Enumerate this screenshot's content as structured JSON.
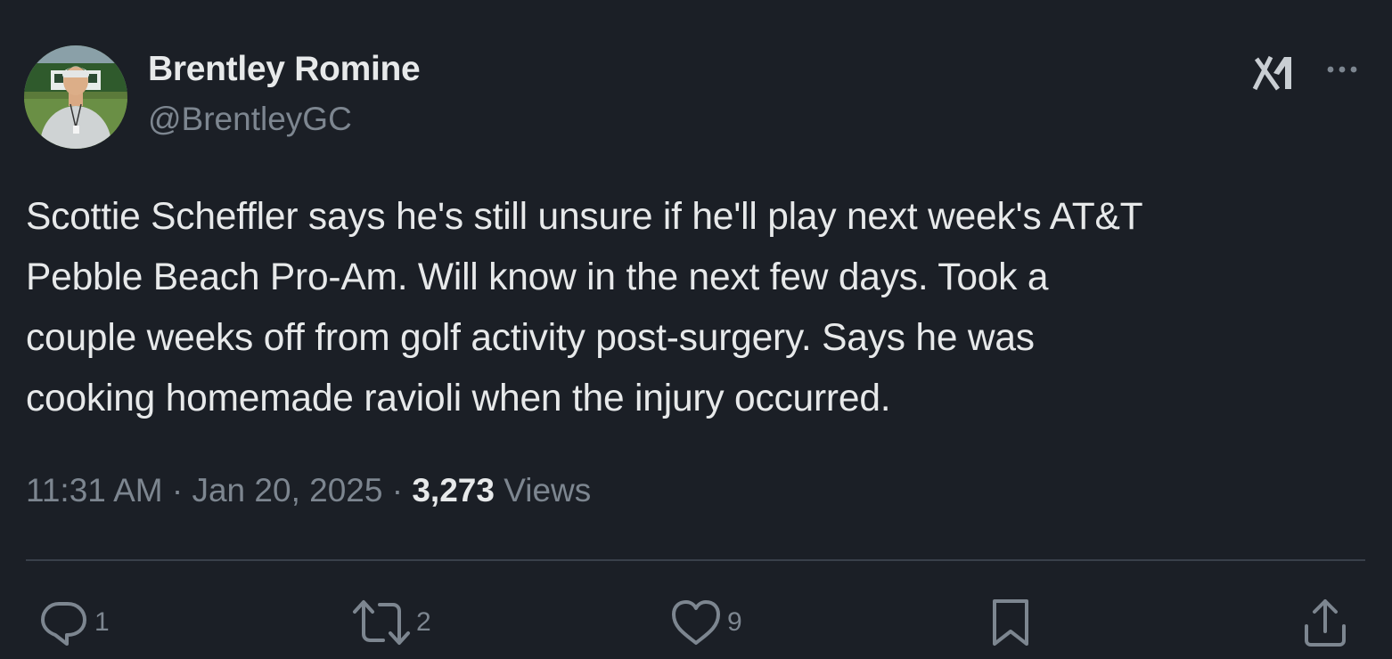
{
  "author": {
    "display_name": "Brentley Romine",
    "handle": "@BrentleyGC",
    "avatar_icon": "profile-photo"
  },
  "header_icons": {
    "logo": "x-logo-icon",
    "more": "more-options-icon"
  },
  "tweet": {
    "text": "Scottie Scheffler says he's still unsure if he'll play next week's AT&T\nPebble Beach Pro-Am. Will know in the next few days. Took a\ncouple weeks off from golf activity post-surgery. Says he was\ncooking homemade ravioli when the injury occurred.",
    "time": "11:31 AM",
    "date": "Jan 20, 2025",
    "separator": "·",
    "views_count": "3,273",
    "views_label": "Views"
  },
  "actions": {
    "reply": {
      "icon": "reply-icon",
      "count": "1"
    },
    "retweet": {
      "icon": "retweet-icon",
      "count": "2"
    },
    "like": {
      "icon": "heart-icon",
      "count": "9"
    },
    "bookmark": {
      "icon": "bookmark-icon"
    },
    "share": {
      "icon": "share-icon"
    }
  },
  "colors": {
    "background": "#1b1f26",
    "primary_text": "#e7e9ea",
    "secondary_text": "#7d8690",
    "divider": "#39404a"
  }
}
